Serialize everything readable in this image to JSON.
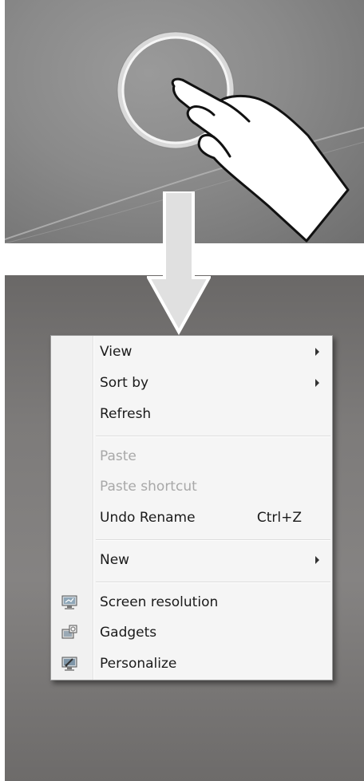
{
  "gesture_illustration": {
    "icons": [
      "touch-ring-icon",
      "hand-pointer-icon"
    ]
  },
  "arrow": {
    "icon": "down-arrow-icon"
  },
  "context_menu": {
    "items": [
      {
        "label": "View",
        "submenu": true,
        "disabled": false
      },
      {
        "label": "Sort by",
        "submenu": true,
        "disabled": false
      },
      {
        "label": "Refresh",
        "submenu": false,
        "disabled": false
      },
      {
        "label": "Paste",
        "submenu": false,
        "disabled": true
      },
      {
        "label": "Paste shortcut",
        "submenu": false,
        "disabled": true
      },
      {
        "label": "Undo Rename",
        "shortcut": "Ctrl+Z",
        "submenu": false,
        "disabled": false
      },
      {
        "label": "New",
        "submenu": true,
        "disabled": false
      },
      {
        "label": "Screen resolution",
        "icon": "display-settings-icon",
        "disabled": false
      },
      {
        "label": "Gadgets",
        "icon": "gadgets-icon",
        "disabled": false
      },
      {
        "label": "Personalize",
        "icon": "personalize-icon",
        "disabled": false
      }
    ]
  },
  "colors": {
    "menu_background": "#f5f5f5",
    "disabled_text": "#a8a8a8",
    "text": "#1a1a1a"
  }
}
